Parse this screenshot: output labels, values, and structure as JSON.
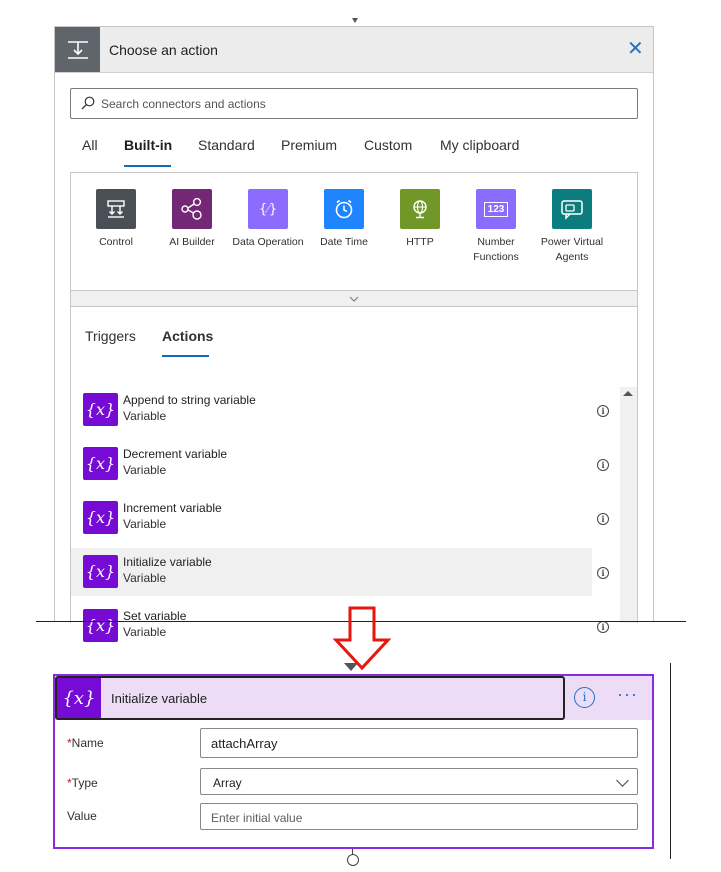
{
  "panel": {
    "title": "Choose an action",
    "search_placeholder": "Search connectors and actions",
    "tabs": [
      "All",
      "Built-in",
      "Standard",
      "Premium",
      "Custom",
      "My clipboard"
    ],
    "active_tab": "Built-in",
    "connectors": [
      {
        "label": "Control",
        "color": "#4a4f55",
        "icon": "control-icon"
      },
      {
        "label": "AI Builder",
        "color": "#742774",
        "icon": "ai-builder-icon"
      },
      {
        "label": "Data Operation",
        "color": "#8c6cff",
        "icon": "data-operation-icon"
      },
      {
        "label": "Date Time",
        "color": "#1f85ff",
        "icon": "clock-icon"
      },
      {
        "label": "HTTP",
        "color": "#709727",
        "icon": "globe-icon"
      },
      {
        "label": "Number Functions",
        "color": "#8c6cff",
        "icon": "number-icon"
      },
      {
        "label": "Power Virtual Agents",
        "color": "#0b7d7e",
        "icon": "chat-icon"
      }
    ],
    "subtabs": [
      "Triggers",
      "Actions"
    ],
    "active_subtab": "Actions",
    "actions": [
      {
        "title": "Append to string variable",
        "subtitle": "Variable"
      },
      {
        "title": "Decrement variable",
        "subtitle": "Variable"
      },
      {
        "title": "Increment variable",
        "subtitle": "Variable"
      },
      {
        "title": "Initialize variable",
        "subtitle": "Variable",
        "selected": true
      },
      {
        "title": "Set variable",
        "subtitle": "Variable"
      }
    ],
    "action_icon_text": "{x}"
  },
  "card": {
    "title": "Initialize variable",
    "icon_text": "{x}",
    "info_text": "i",
    "more_text": "···",
    "fields": {
      "name_label": "Name",
      "name_value": "attachArray",
      "type_label": "Type",
      "type_value": "Array",
      "value_label": "Value",
      "value_placeholder": "Enter initial value",
      "required_mark": "*"
    }
  },
  "colors": {
    "variable_purple": "#770bd6",
    "card_border": "#8a2be2",
    "card_header_bg": "#ecdcf5",
    "accent_blue": "#0f6cbd",
    "arrow_red": "#e8160c"
  }
}
